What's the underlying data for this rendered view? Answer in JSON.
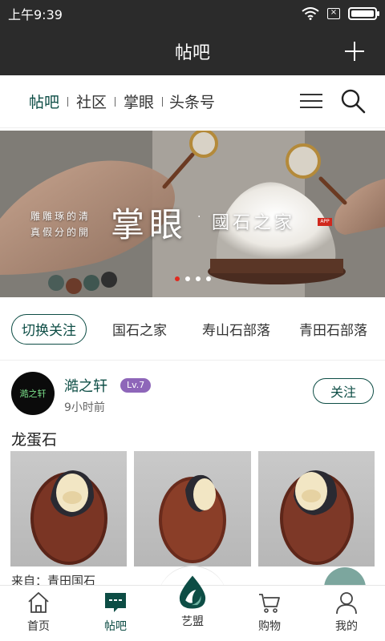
{
  "status_bar": {
    "time": "上午9:39"
  },
  "header": {
    "title": "帖吧"
  },
  "tabs": [
    {
      "label": "帖吧",
      "active": true
    },
    {
      "label": "社区",
      "active": false
    },
    {
      "label": "掌眼",
      "active": false
    },
    {
      "label": "头条号",
      "active": false
    }
  ],
  "banner": {
    "title": "掌眼",
    "subtitle": "國石之家",
    "badge": "APP",
    "poem_line1": "雕雕琢的清",
    "poem_line2": "真假分的開",
    "slides": 4,
    "active_slide": 1
  },
  "categories": {
    "switch_label": "切换关注",
    "items": [
      "国石之家",
      "寿山石部落",
      "青田石部落"
    ]
  },
  "post": {
    "avatar_text": "澔之轩",
    "user": "澔之轩",
    "level": "Lv.7",
    "time": "9小时前",
    "follow_label": "关注",
    "title": "龙蛋石",
    "source": "来自：青田国石"
  },
  "bottom_nav": [
    {
      "label": "首页",
      "icon": "home-icon",
      "active": false
    },
    {
      "label": "帖吧",
      "icon": "forum-icon",
      "active": true
    },
    {
      "label": "艺盟",
      "icon": "drop-logo-icon",
      "active": false
    },
    {
      "label": "购物",
      "icon": "cart-icon",
      "active": false
    },
    {
      "label": "我的",
      "icon": "user-icon",
      "active": false
    }
  ],
  "colors": {
    "accent": "#0d4d45",
    "dark_bar": "#2b2b2b",
    "badge": "#8e66b9",
    "active_dot": "#e02a1f"
  }
}
